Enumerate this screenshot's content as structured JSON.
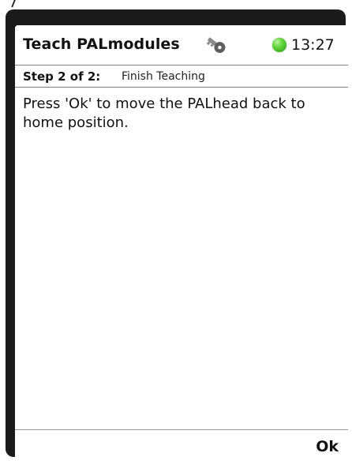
{
  "header": {
    "title": "Teach PALmodules",
    "key_icon": "key-icon",
    "status_led_color": "#4cc22a",
    "time": "13:27"
  },
  "step": {
    "label": "Step 2 of 2:",
    "name": "Finish Teaching"
  },
  "content": {
    "instruction": "Press 'Ok' to move the PALhead back to home position."
  },
  "footer": {
    "ok_label": "Ok"
  }
}
